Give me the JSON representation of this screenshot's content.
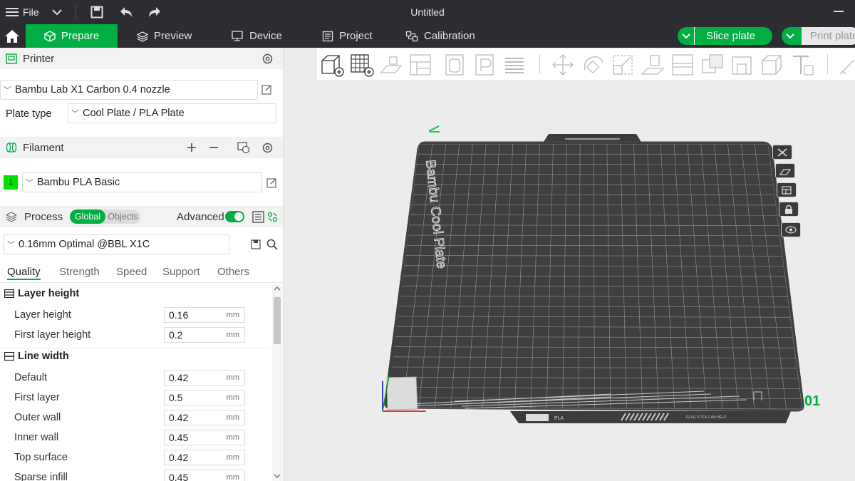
{
  "window": {
    "title": "Untitled",
    "file_menu": "File"
  },
  "tabs": [
    {
      "label": "Prepare",
      "icon": "cube-icon",
      "active": true
    },
    {
      "label": "Preview",
      "icon": "layers-icon"
    },
    {
      "label": "Device",
      "icon": "device-icon"
    },
    {
      "label": "Project",
      "icon": "project-icon"
    },
    {
      "label": "Calibration",
      "icon": "calibration-icon"
    }
  ],
  "actions": {
    "slice": "Slice plate",
    "print": "Print plate"
  },
  "printer": {
    "section": "Printer",
    "selected": "Bambu Lab X1 Carbon 0.4 nozzle",
    "plate_type_label": "Plate type",
    "plate_type": "Cool Plate / PLA Plate"
  },
  "filament": {
    "section": "Filament",
    "slot_number": "1",
    "slot_color": "#00e000",
    "selected": "Bambu PLA Basic"
  },
  "process": {
    "section": "Process",
    "toggle_global": "Global",
    "toggle_objects": "Objects",
    "advanced_label": "Advanced",
    "advanced_on": true,
    "preset": "0.16mm Optimal @BBL X1C",
    "tabs": [
      "Quality",
      "Strength",
      "Speed",
      "Support",
      "Others"
    ]
  },
  "settings": {
    "group1": {
      "title": "Layer height",
      "rows": [
        {
          "label": "Layer height",
          "value": "0.16",
          "unit": "mm"
        },
        {
          "label": "First layer height",
          "value": "0.2",
          "unit": "mm"
        }
      ]
    },
    "group2": {
      "title": "Line width",
      "rows": [
        {
          "label": "Default",
          "value": "0.42",
          "unit": "mm"
        },
        {
          "label": "First layer",
          "value": "0.5",
          "unit": "mm"
        },
        {
          "label": "Outer wall",
          "value": "0.42",
          "unit": "mm"
        },
        {
          "label": "Inner wall",
          "value": "0.45",
          "unit": "mm"
        },
        {
          "label": "Top surface",
          "value": "0.42",
          "unit": "mm"
        },
        {
          "label": "Sparse infill",
          "value": "0.45",
          "unit": "mm"
        }
      ]
    }
  },
  "plate": {
    "brand_text": "Bambu Cool Plate",
    "number": "01",
    "bottom_label": "PLA",
    "sticker_text": "GLUE STICK CAN HELP"
  },
  "colors": {
    "accent": "#00ae42",
    "dark": "#2b2d31",
    "plate": "#3d3f41"
  }
}
